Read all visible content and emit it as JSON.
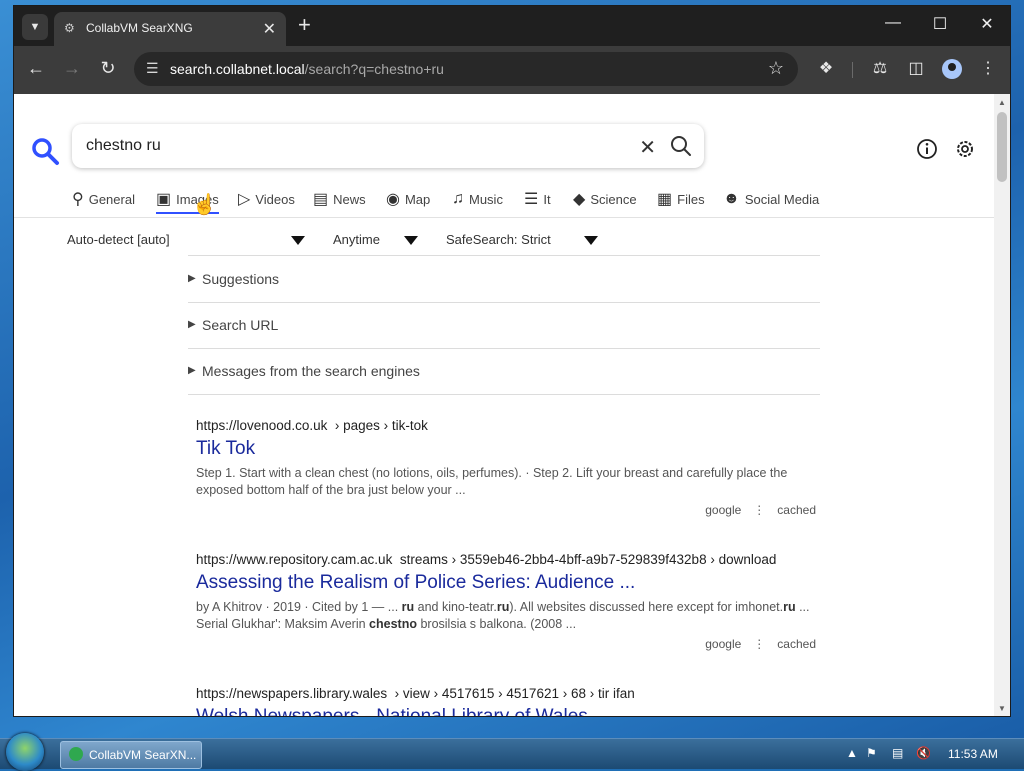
{
  "browser": {
    "tab_title": "CollabVM SearXNG",
    "url_host": "search.collabnet.local",
    "url_path": "/search?q=chestno+ru"
  },
  "search": {
    "query": "chestno ru"
  },
  "categories": [
    {
      "label": "General",
      "icon": "search-icon"
    },
    {
      "label": "Images",
      "icon": "image-icon"
    },
    {
      "label": "Videos",
      "icon": "play-icon"
    },
    {
      "label": "News",
      "icon": "newspaper-icon"
    },
    {
      "label": "Map",
      "icon": "map-pin-icon"
    },
    {
      "label": "Music",
      "icon": "music-icon"
    },
    {
      "label": "It",
      "icon": "layers-icon"
    },
    {
      "label": "Science",
      "icon": "graduation-cap-icon"
    },
    {
      "label": "Files",
      "icon": "box-icon"
    },
    {
      "label": "Social Media",
      "icon": "people-icon"
    }
  ],
  "filters": {
    "language": "Auto-detect [auto]",
    "time": "Anytime",
    "safesearch": "SafeSearch: Strict"
  },
  "sections": {
    "suggestions": "Suggestions",
    "search_url": "Search URL",
    "messages": "Messages from the search engines"
  },
  "results": [
    {
      "url": "https://lovenood.co.uk",
      "path": "› pages › tik-tok",
      "title": "Tik Tok",
      "content": "Step 1. Start with a clean chest (no lotions, oils, perfumes). · Step 2. Lift your breast and carefully place the exposed bottom half of the bra just below your ...",
      "engine": "google",
      "cached": "cached"
    },
    {
      "url": "https://www.repository.cam.ac.uk",
      "path": "streams › 3559eb46-2bb4-4bff-a9b7-529839f432b8 › download",
      "title": "Assessing the Realism of Police Series: Audience ...",
      "content_parts": [
        "by A Khitrov · 2019 · Cited by 1 — ... ",
        "ru",
        " and kino-teatr.",
        "ru",
        "). All websites discussed here except for imhonet.",
        "ru",
        " ... Serial Glukhar': Maksim Averin ",
        "chestno",
        " brosilsia s balkona. (2008 ..."
      ],
      "engine": "google",
      "cached": "cached"
    },
    {
      "url": "https://newspapers.library.wales",
      "path": "› view › 4517615 › 4517621 › 68 › tir ifan",
      "title": "Welsh Newspapers - National Library of Wales"
    }
  ],
  "taskbar": {
    "task_label": "CollabVM SearXN...",
    "clock": "11:53 AM"
  },
  "colors": {
    "accent": "#3050ff",
    "link": "#1a2a9c"
  }
}
